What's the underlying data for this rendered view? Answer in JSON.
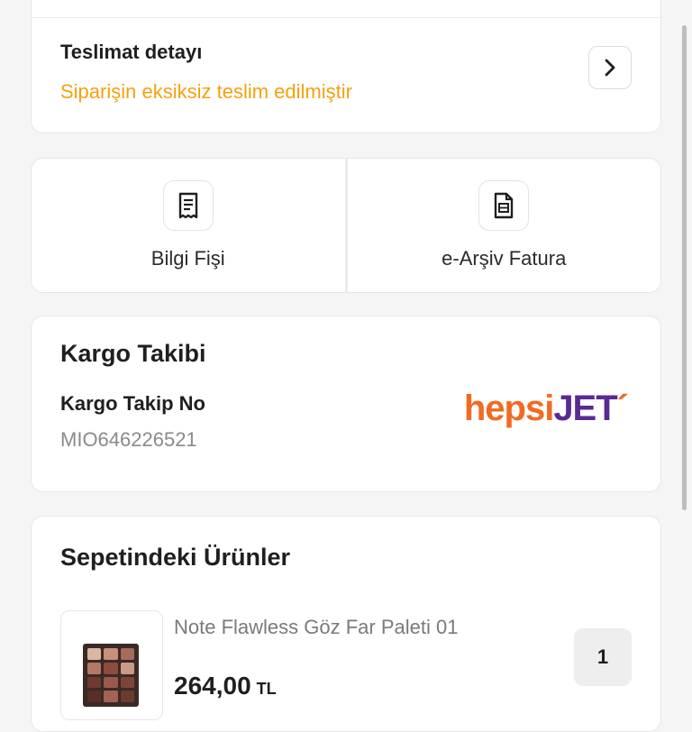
{
  "delivery": {
    "title": "Teslimat detayı",
    "status": "Siparişin eksiksiz teslim edilmiştir",
    "status_color": "#f5a00f",
    "icon": "chevron-right-icon"
  },
  "documents": [
    {
      "label": "Bilgi Fişi",
      "icon": "receipt-icon"
    },
    {
      "label": "e-Arşiv Fatura",
      "icon": "invoice-icon"
    }
  ],
  "cargo": {
    "title": "Kargo Takibi",
    "tracking_label": "Kargo Takip No",
    "tracking_no": "MIO646226521",
    "carrier_logo_part1": "hepsi",
    "carrier_logo_part2": "JET",
    "logo_colors": [
      "#f26a21",
      "#5a2a93"
    ]
  },
  "basket": {
    "title": "Sepetindeki Ürünler",
    "items": [
      {
        "name": "Note Flawless Göz Far Paleti 01",
        "price": "264,00",
        "currency": "TL",
        "quantity": "1"
      }
    ]
  }
}
